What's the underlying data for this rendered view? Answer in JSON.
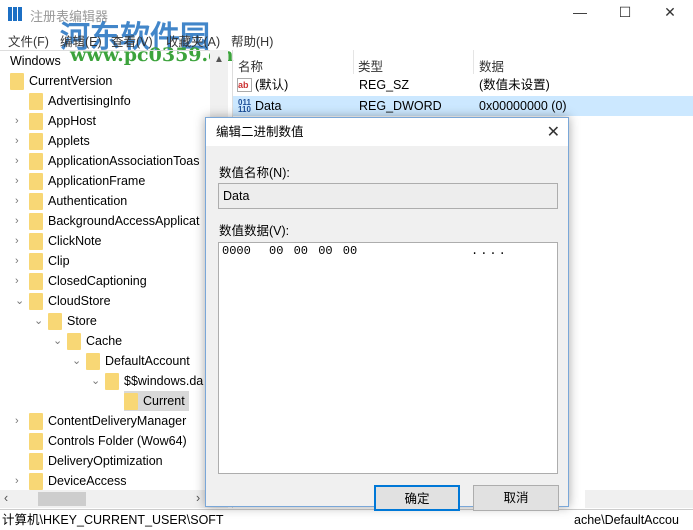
{
  "window": {
    "title": "注册表编辑器",
    "minimize": "—",
    "maximize": "☐",
    "close": "✕"
  },
  "watermark": {
    "name": "河东软件园",
    "url": "www.pc0359.cn"
  },
  "menu": [
    "文件(F)",
    "编辑(E)",
    "查看(V)",
    "收藏夹(A)",
    "帮助(H)"
  ],
  "tree": [
    {
      "label": "Windows",
      "level": 0,
      "chev": ""
    },
    {
      "label": "CurrentVersion",
      "level": 0,
      "chev": ""
    },
    {
      "label": "AdvertisingInfo",
      "level": 1,
      "chev": ""
    },
    {
      "label": "AppHost",
      "level": 1,
      "chev": ">"
    },
    {
      "label": "Applets",
      "level": 1,
      "chev": ">"
    },
    {
      "label": "ApplicationAssociationToas",
      "level": 1,
      "chev": ">"
    },
    {
      "label": "ApplicationFrame",
      "level": 1,
      "chev": ">"
    },
    {
      "label": "Authentication",
      "level": 1,
      "chev": ">"
    },
    {
      "label": "BackgroundAccessApplicat",
      "level": 1,
      "chev": ">"
    },
    {
      "label": "ClickNote",
      "level": 1,
      "chev": ">"
    },
    {
      "label": "Clip",
      "level": 1,
      "chev": ">"
    },
    {
      "label": "ClosedCaptioning",
      "level": 1,
      "chev": ">"
    },
    {
      "label": "CloudStore",
      "level": 1,
      "chev": "v"
    },
    {
      "label": "Store",
      "level": 2,
      "chev": "v"
    },
    {
      "label": "Cache",
      "level": 3,
      "chev": "v"
    },
    {
      "label": "DefaultAccount",
      "level": 4,
      "chev": "v"
    },
    {
      "label": "$$windows.da",
      "level": 5,
      "chev": "v"
    },
    {
      "label": "Current",
      "level": 6,
      "chev": "",
      "selected": true
    },
    {
      "label": "ContentDeliveryManager",
      "level": 1,
      "chev": ">"
    },
    {
      "label": "Controls Folder (Wow64)",
      "level": 1,
      "chev": ""
    },
    {
      "label": "DeliveryOptimization",
      "level": 1,
      "chev": ""
    },
    {
      "label": "DeviceAccess",
      "level": 1,
      "chev": ">"
    }
  ],
  "list": {
    "columns": [
      "名称",
      "类型",
      "数据"
    ],
    "rows": [
      {
        "icon": "string-value-icon",
        "name": "(默认)",
        "type": "REG_SZ",
        "data": "(数值未设置)"
      },
      {
        "icon": "binary-value-icon",
        "name": "Data",
        "type": "REG_DWORD",
        "data": "0x00000000 (0)",
        "selected": true
      }
    ]
  },
  "status": {
    "left": "计算机\\HKEY_CURRENT_USER\\SOFT",
    "right": "ache\\DefaultAccou"
  },
  "dialog": {
    "title": "编辑二进制数值",
    "name_label": "数值名称(N):",
    "name_value": "Data",
    "data_label": "数值数据(V):",
    "hex_offset": "0000",
    "hex_bytes": "00 00 00 00",
    "hex_ascii": "....",
    "ok": "确定",
    "cancel": "取消"
  }
}
